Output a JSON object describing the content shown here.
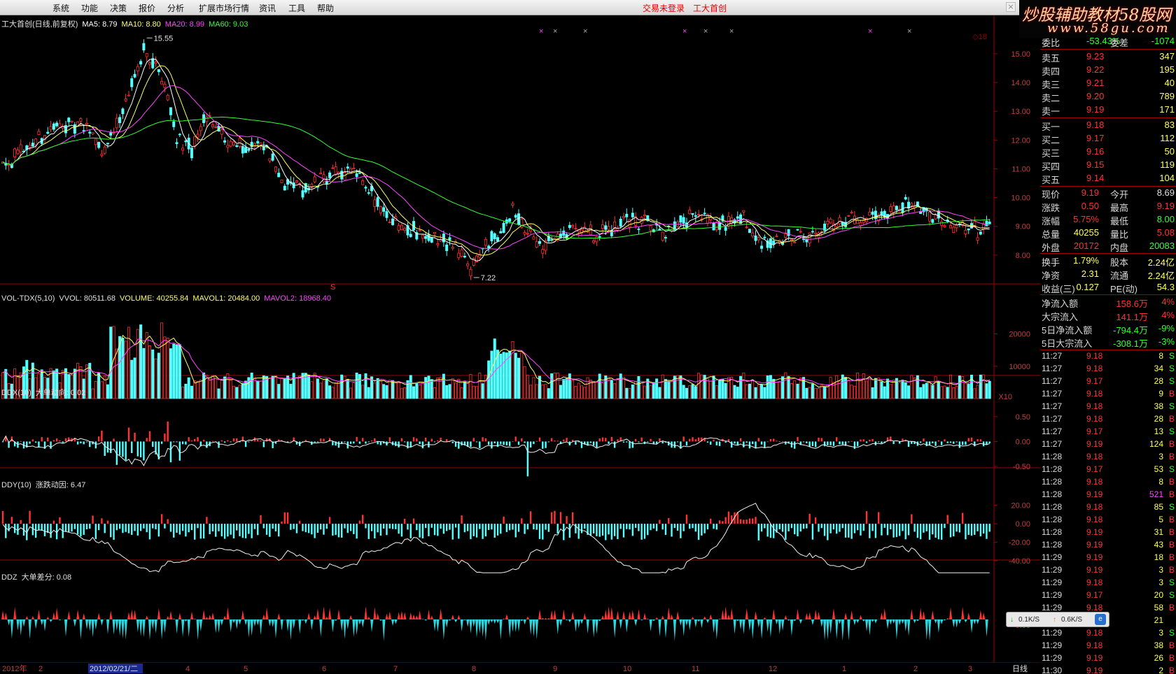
{
  "menu": [
    "系统",
    "功能",
    "决策",
    "报价",
    "分析",
    "扩展市场行情",
    "资讯",
    "工具",
    "帮助"
  ],
  "status": {
    "login": "交易未登录",
    "stock_name": "工大首创"
  },
  "window": {
    "close_label": "×"
  },
  "watermark": {
    "line1": "炒股辅助教材58股网",
    "line2": "www.58gu.com"
  },
  "kline_panel": {
    "title": "工大首创(日线,前复权)",
    "ma5": "MA5: 8.79",
    "ma10": "MA10: 8.80",
    "ma20": "MA20: 8.99",
    "ma60": "MA60: 9.03",
    "high_label": "15.55",
    "low_label": "7.22",
    "corner_label": "◇18",
    "marker": "S",
    "yticks": [
      "15.00",
      "14.00",
      "13.00",
      "12.00",
      "11.00",
      "10.00",
      "9.00",
      "8.00"
    ]
  },
  "vol_panel": {
    "title": "VOL-TDX(5,10)",
    "vvol": "VVOL: 80511.68",
    "volume": "VOLUME: 40255.84",
    "mavol1": "MAVOL1: 20484.00",
    "mavol2": "MAVOL2: 18968.40",
    "yticks": [
      "20000",
      "10000"
    ],
    "unit": "X10"
  },
  "ddx_panel": {
    "title": "DDX(10)",
    "value": "大单动向: 0.02",
    "yticks": [
      "0.50",
      "0.00",
      "-0.50"
    ]
  },
  "ddy_panel": {
    "title": "DDY(10)",
    "value": "涨跌动因: 6.47",
    "yticks": [
      "20.00",
      "0.00",
      "-20.00",
      "-40.00"
    ]
  },
  "ddz_panel": {
    "title": "DDZ",
    "value": "大单差分: 0.08",
    "yticks": [
      "0.00"
    ]
  },
  "date_axis": {
    "year": "2012年",
    "selected": "2012/02/21/二",
    "months": [
      "2",
      "4",
      "5",
      "6",
      "7",
      "8",
      "9",
      "10",
      "11",
      "12",
      "1",
      "2",
      "3"
    ],
    "period": "日线"
  },
  "chart_data": [
    {
      "type": "candlestick",
      "title": "工大首创(日线,前复权)",
      "ylim": [
        7.0,
        15.8
      ],
      "annotations": [
        {
          "label": "15.55",
          "value": 15.55
        },
        {
          "label": "7.22",
          "value": 7.22
        }
      ],
      "series_overlay": [
        {
          "name": "MA5",
          "value": 8.79,
          "color": "#ffffff"
        },
        {
          "name": "MA10",
          "value": 8.8,
          "color": "#ffff66"
        },
        {
          "name": "MA20",
          "value": 8.99,
          "color": "#ff44ff"
        },
        {
          "name": "MA60",
          "value": 9.03,
          "color": "#33ff33"
        }
      ],
      "close_path": [
        [
          0,
          11.2
        ],
        [
          6,
          11.5
        ],
        [
          12,
          12.1
        ],
        [
          20,
          12.6
        ],
        [
          28,
          12.4
        ],
        [
          34,
          11.6
        ],
        [
          40,
          13.0
        ],
        [
          47,
          15.2
        ],
        [
          53,
          14.3
        ],
        [
          58,
          12.2
        ],
        [
          63,
          11.6
        ],
        [
          68,
          12.9
        ],
        [
          74,
          12.0
        ],
        [
          80,
          11.8
        ],
        [
          88,
          11.7
        ],
        [
          94,
          10.5
        ],
        [
          100,
          10.3
        ],
        [
          108,
          10.7
        ],
        [
          116,
          10.9
        ],
        [
          122,
          10.2
        ],
        [
          128,
          9.4
        ],
        [
          136,
          8.9
        ],
        [
          144,
          8.6
        ],
        [
          150,
          8.4
        ],
        [
          156,
          7.5
        ],
        [
          160,
          8.2
        ],
        [
          166,
          8.8
        ],
        [
          170,
          9.5
        ],
        [
          174,
          8.9
        ],
        [
          180,
          8.3
        ],
        [
          186,
          8.7
        ],
        [
          192,
          9.0
        ],
        [
          198,
          8.6
        ],
        [
          206,
          9.2
        ],
        [
          214,
          9.1
        ],
        [
          222,
          8.7
        ],
        [
          230,
          9.4
        ],
        [
          238,
          9.0
        ],
        [
          246,
          9.3
        ],
        [
          254,
          8.4
        ],
        [
          262,
          8.6
        ],
        [
          270,
          8.8
        ],
        [
          278,
          9.1
        ],
        [
          286,
          9.2
        ],
        [
          294,
          9.5
        ],
        [
          302,
          9.7
        ],
        [
          310,
          9.3
        ],
        [
          318,
          9.0
        ],
        [
          325,
          8.8
        ],
        [
          330,
          9.2
        ]
      ]
    },
    {
      "type": "bar",
      "title": "VOL-TDX(5,10)",
      "ylim": [
        0,
        32000
      ],
      "series": [
        {
          "name": "VOLUME",
          "last": 40255.84
        },
        {
          "name": "MAVOL1",
          "last": 20484.0
        },
        {
          "name": "MAVOL2",
          "last": 18968.4
        }
      ]
    },
    {
      "type": "bar",
      "title": "DDX(10)",
      "ylim": [
        -0.85,
        0.75
      ],
      "series": [
        {
          "name": "大单动向",
          "last": 0.02
        }
      ]
    },
    {
      "type": "bar",
      "title": "DDY(10)",
      "ylim": [
        -55,
        28
      ],
      "series": [
        {
          "name": "涨跌动因",
          "last": 6.47
        }
      ]
    },
    {
      "type": "area",
      "title": "DDZ",
      "series": [
        {
          "name": "大单差分",
          "last": 0.08
        }
      ]
    }
  ],
  "quote": {
    "partial": {
      "l1": "委比",
      "v1": "-53.43%",
      "l2": "委差",
      "v2": "-1074"
    },
    "asks": [
      {
        "label": "卖五",
        "price": "9.23",
        "vol": "347"
      },
      {
        "label": "卖四",
        "price": "9.22",
        "vol": "195"
      },
      {
        "label": "卖三",
        "price": "9.21",
        "vol": "40"
      },
      {
        "label": "卖二",
        "price": "9.20",
        "vol": "789"
      },
      {
        "label": "卖一",
        "price": "9.19",
        "vol": "171"
      }
    ],
    "bids": [
      {
        "label": "买一",
        "price": "9.18",
        "vol": "83"
      },
      {
        "label": "买二",
        "price": "9.17",
        "vol": "112"
      },
      {
        "label": "买三",
        "price": "9.16",
        "vol": "50"
      },
      {
        "label": "买四",
        "price": "9.15",
        "vol": "119"
      },
      {
        "label": "买五",
        "price": "9.14",
        "vol": "104"
      }
    ],
    "stats": [
      {
        "l1": "现价",
        "v1": "9.19",
        "c1": "#ff3333",
        "l2": "今开",
        "v2": "8.69",
        "c2": "#e0e0e0"
      },
      {
        "l1": "涨跌",
        "v1": "0.50",
        "c1": "#ff3333",
        "l2": "最高",
        "v2": "9.19",
        "c2": "#ff3333"
      },
      {
        "l1": "涨幅",
        "v1": "5.75%",
        "c1": "#ff3333",
        "l2": "最低",
        "v2": "8.00",
        "c2": "#33ff33"
      },
      {
        "l1": "总量",
        "v1": "40255",
        "c1": "#ffff66",
        "l2": "量比",
        "v2": "5.08",
        "c2": "#ff3333"
      },
      {
        "l1": "外盘",
        "v1": "20172",
        "c1": "#ff3333",
        "l2": "内盘",
        "v2": "20083",
        "c2": "#33ff33"
      }
    ],
    "info": [
      {
        "l1": "换手",
        "v1": "1.79%",
        "l2": "股本",
        "v2": "2.24亿"
      },
      {
        "l1": "净资",
        "v1": "2.31",
        "l2": "流通",
        "v2": "2.24亿"
      },
      {
        "l1": "收益(三)",
        "v1": "0.127",
        "l2": "PE(动)",
        "v2": "54.3"
      }
    ],
    "flows": [
      {
        "label": "净流入额",
        "val": "158.6万",
        "pct": "4%",
        "color": "#ff3333"
      },
      {
        "label": "大宗流入",
        "val": "141.1万",
        "pct": "4%",
        "color": "#ff3333"
      },
      {
        "label": "5日净流入额",
        "val": "-794.4万",
        "pct": "-9%",
        "color": "#33ff33"
      },
      {
        "label": "5日大宗流入",
        "val": "-308.1万",
        "pct": "-3%",
        "color": "#33ff33"
      }
    ],
    "ticks": [
      {
        "time": "11:27",
        "price": "9.18",
        "vol": "8",
        "bs": "S"
      },
      {
        "time": "11:27",
        "price": "9.18",
        "vol": "34",
        "bs": "S"
      },
      {
        "time": "11:27",
        "price": "9.17",
        "vol": "28",
        "bs": "S"
      },
      {
        "time": "11:27",
        "price": "9.18",
        "vol": "9",
        "bs": "B"
      },
      {
        "time": "11:27",
        "price": "9.18",
        "vol": "38",
        "bs": "S"
      },
      {
        "time": "11:27",
        "price": "9.18",
        "vol": "28",
        "bs": "B"
      },
      {
        "time": "11:27",
        "price": "9.17",
        "vol": "13",
        "bs": "S"
      },
      {
        "time": "11:27",
        "price": "9.19",
        "vol": "124",
        "bs": "B"
      },
      {
        "time": "11:28",
        "price": "9.18",
        "vol": "3",
        "bs": "B"
      },
      {
        "time": "11:28",
        "price": "9.17",
        "vol": "53",
        "bs": "S"
      },
      {
        "time": "11:28",
        "price": "9.18",
        "vol": "8",
        "bs": "B"
      },
      {
        "time": "11:28",
        "price": "9.19",
        "vol": "521",
        "bs": "B"
      },
      {
        "time": "11:28",
        "price": "9.18",
        "vol": "85",
        "bs": "S"
      },
      {
        "time": "11:28",
        "price": "9.18",
        "vol": "5",
        "bs": "B"
      },
      {
        "time": "11:28",
        "price": "9.19",
        "vol": "31",
        "bs": "B"
      },
      {
        "time": "11:28",
        "price": "9.19",
        "vol": "43",
        "bs": "B"
      },
      {
        "time": "11:29",
        "price": "9.19",
        "vol": "18",
        "bs": "B"
      },
      {
        "time": "11:29",
        "price": "9.19",
        "vol": "3",
        "bs": "B"
      },
      {
        "time": "11:29",
        "price": "9.18",
        "vol": "3",
        "bs": "S"
      },
      {
        "time": "11:29",
        "price": "9.17",
        "vol": "20",
        "bs": "S"
      },
      {
        "time": "11:29",
        "price": "9.18",
        "vol": "58",
        "bs": "B"
      },
      {
        "time": "11:29",
        "price": "9.18",
        "vol": "21",
        "bs": ""
      },
      {
        "time": "11:29",
        "price": "9.18",
        "vol": "3",
        "bs": "S"
      },
      {
        "time": "11:29",
        "price": "9.18",
        "vol": "38",
        "bs": "B"
      },
      {
        "time": "11:29",
        "price": "9.19",
        "vol": "26",
        "bs": "B"
      },
      {
        "time": "11:30",
        "price": "9.19",
        "vol": "2",
        "bs": "B"
      }
    ]
  },
  "net_speed": {
    "down": "0.1K/S",
    "up": "0.6K/S"
  }
}
